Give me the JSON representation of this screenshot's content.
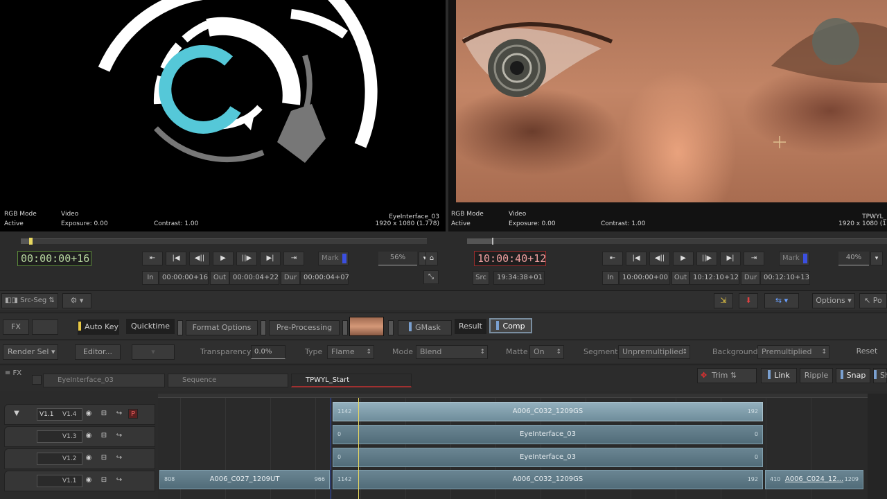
{
  "viewer_left": {
    "mode": "RGB Mode",
    "state": "Active",
    "layer": "Video",
    "exposure": "Exposure: 0.00",
    "contrast": "Contrast: 1.00",
    "clip_name": "EyeInterface_03",
    "resolution": "1920 x 1080 (1.778)"
  },
  "viewer_right": {
    "mode": "RGB Mode",
    "state": "Active",
    "layer": "Video",
    "exposure": "Exposure: 0.00",
    "contrast": "Contrast: 1.00",
    "clip_name": "TPWYL_",
    "resolution": "1920 x 1080 (1"
  },
  "transport_left": {
    "timecode": "00:00:00+16",
    "zoom": "56%",
    "mark": "Mark",
    "in_label": "In",
    "in_value": "00:00:00+16",
    "out_label": "Out",
    "out_value": "00:00:04+22",
    "dur_label": "Dur",
    "dur_value": "00:00:04+07",
    "scrub_progress": 0.02
  },
  "transport_right": {
    "timecode": "10:00:40+12",
    "zoom": "40%",
    "mark": "Mark",
    "src_label": "Src",
    "src_value": "19:34:38+01",
    "in_label": "In",
    "in_value": "10:00:00+00",
    "out_label": "Out",
    "out_value": "10:12:10+12",
    "dur_label": "Dur",
    "dur_value": "00:12:10+13",
    "scrub_progress": 0.06
  },
  "toolbar": {
    "src_seq": "Src-Seg",
    "options": "Options"
  },
  "fx_bar": {
    "fx": "FX",
    "auto_key": "Auto Key",
    "quicktime": "Quicktime",
    "format_options": "Format Options",
    "pre_processing": "Pre-Processing",
    "gmask": "GMask",
    "result": "Result",
    "comp": "Comp"
  },
  "props_bar": {
    "render_sel": "Render Sel",
    "editor": "Editor...",
    "transparency_label": "Transparency",
    "transparency_value": "0.0%",
    "type_label": "Type",
    "type_value": "Flame",
    "mode_label": "Mode",
    "mode_value": "Blend",
    "matte_label": "Matte",
    "matte_value": "On",
    "segment_label": "Segment",
    "segment_value": "Unpremultiplied",
    "background_label": "Background",
    "background_value": "Premultiplied",
    "reset": "Reset"
  },
  "tabs_bar": {
    "fx": "FX",
    "tabs": [
      "EyeInterface_03",
      "Sequence",
      "TPWYL_Start"
    ],
    "trim": "Trim",
    "link": "Link",
    "ripple": "Ripple",
    "snap": "Snap",
    "shift": "Sh"
  },
  "tracks": [
    {
      "name": "V1.1",
      "alt": "V1.4",
      "patch": "P"
    },
    {
      "name": "",
      "alt": "V1.3"
    },
    {
      "name": "",
      "alt": "V1.2"
    },
    {
      "name": "",
      "alt": "V1.1"
    }
  ],
  "clips": {
    "top": {
      "name": "A006_C032_1209GS",
      "in": "1142",
      "out": "192"
    },
    "mid1": {
      "name": "EyeInterface_03",
      "in": "0",
      "out": "0"
    },
    "mid2": {
      "name": "EyeInterface_03",
      "in": "0",
      "out": "0"
    },
    "bot_a": {
      "name": "A006_C027_1209UT",
      "in": "808",
      "out": "966"
    },
    "bot_b": {
      "name": "A006_C032_1209GS",
      "in": "1142",
      "out": "192"
    },
    "bot_c": {
      "name": "A006_C024_12...",
      "in": "410",
      "out": "1209"
    }
  },
  "colors": {
    "accent_blue": "#3b4fe0",
    "timecode_green": "#b8d8a0",
    "timecode_red": "#f0a0a0",
    "clip": "#6f8d9b",
    "playhead": "#e8d860"
  }
}
